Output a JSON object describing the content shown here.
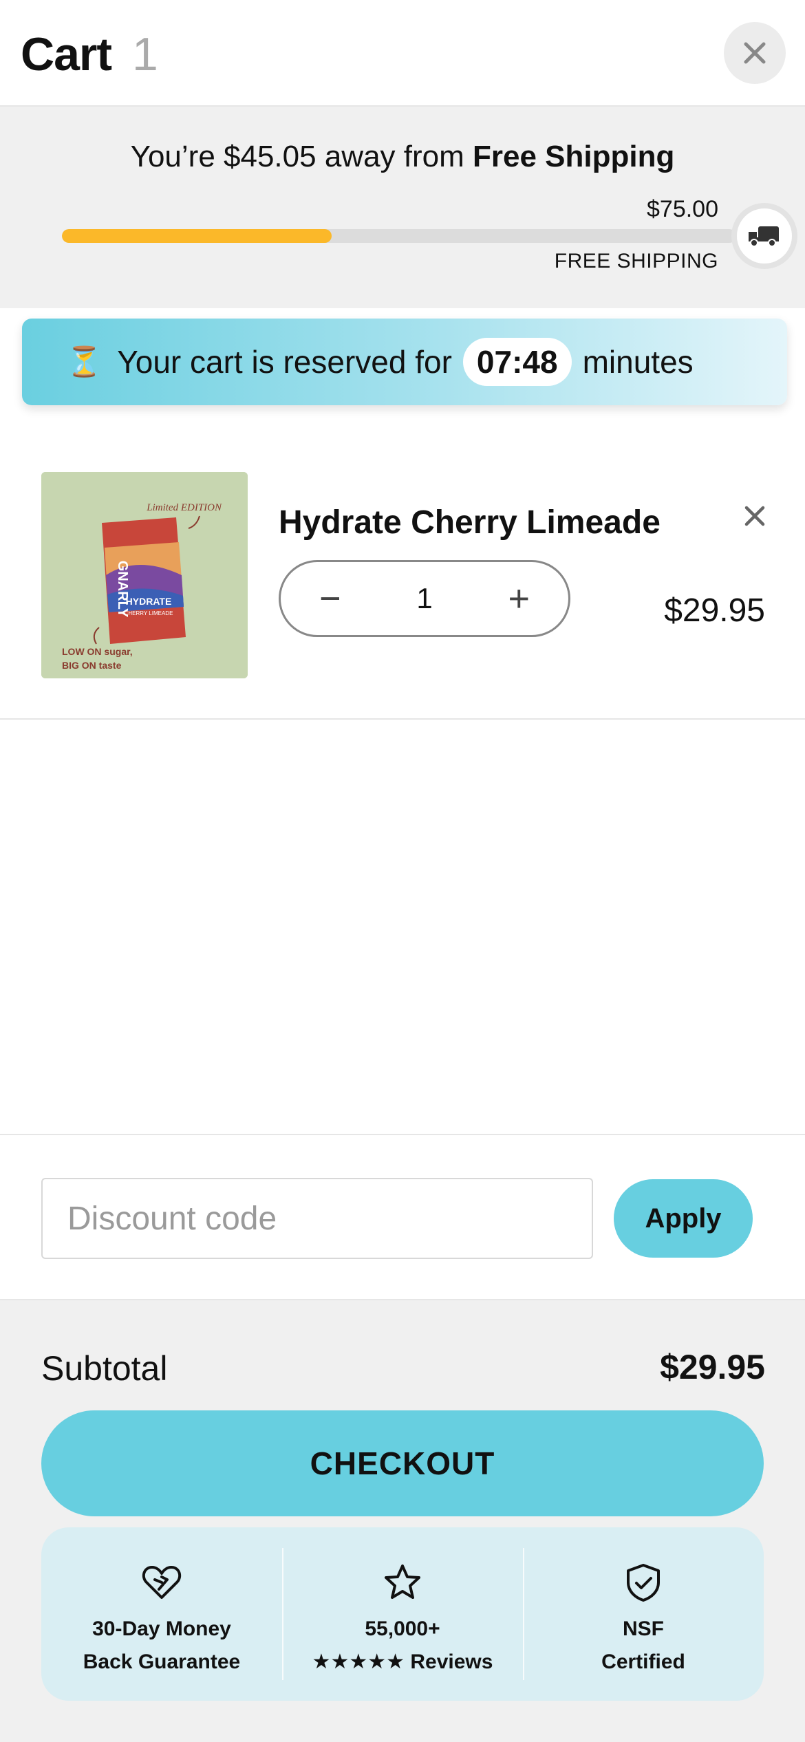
{
  "header": {
    "title": "Cart",
    "count": "1",
    "close_icon": "close-icon"
  },
  "shipping": {
    "message_prefix": "You’re $45.05 away from ",
    "message_bold": "Free Shipping",
    "threshold": "$75.00",
    "label": "FREE SHIPPING",
    "progress_fraction": 0.4,
    "progress_color": "#fbb829",
    "icon": "truck-icon"
  },
  "reserve": {
    "icon": "⏳",
    "prefix": "Your cart is reserved for",
    "timer": "07:48",
    "suffix": "minutes"
  },
  "item": {
    "name": "Hydrate Cherry Limeade",
    "quantity": "1",
    "price": "$29.95",
    "minus": "−",
    "plus": "+",
    "image": {
      "edition": "Limited EDITION",
      "brand": "GNARLY",
      "product": "HYDRATE",
      "flavor": "CHERRY LIMEADE",
      "tagline_1": "LOW ON sugar,",
      "tagline_2": "BIG ON taste"
    }
  },
  "discount": {
    "placeholder": "Discount code",
    "apply_label": "Apply"
  },
  "summary": {
    "subtotal_label": "Subtotal",
    "subtotal_value": "$29.95",
    "checkout_label": "CHECKOUT"
  },
  "trust": [
    {
      "icon": "heart-check-icon",
      "line1": "30-Day Money",
      "line2": "Back Guarantee"
    },
    {
      "icon": "star-icon",
      "line1": "55,000+",
      "line2": "★★★★★ Reviews"
    },
    {
      "icon": "shield-check-icon",
      "line1": "NSF",
      "line2": "Certified"
    }
  ],
  "colors": {
    "accent": "#67cfe0",
    "progress": "#fbb829",
    "footer_bg": "#f0f0f0",
    "trust_bg": "#d9eef3"
  }
}
